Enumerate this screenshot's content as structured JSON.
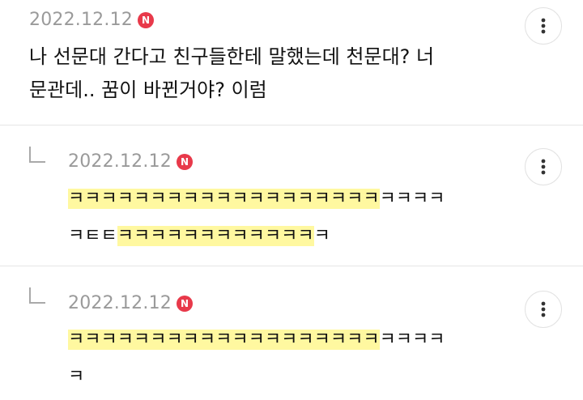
{
  "comments": [
    {
      "date": "2022.12.12",
      "badge": "N",
      "lines": [
        "나 선문대 간다고 친구들한테 말했는데 천문대? 너",
        "문관데.. 꿈이 바뀐거야? 이럼"
      ]
    },
    {
      "date": "2022.12.12",
      "badge": "N",
      "line1_highlight": "ㅋㅋㅋㅋㅋㅋㅋㅋㅋㅋㅋㅋㅋㅋㅋㅋㅋㅋㅋ",
      "line1_rest": "ㅋㅋㅋㅋ",
      "line2_pre": "ㅋㅌㅌ",
      "line2_highlight": "ㅋㅋㅋㅋㅋㅋㅋㅋㅋㅋㅋㅋ",
      "line2_rest": "ㅋ"
    },
    {
      "date": "2022.12.12",
      "badge": "N",
      "line1_highlight": "ㅋㅋㅋㅋㅋㅋㅋㅋㅋㅋㅋㅋㅋㅋㅋㅋㅋㅋㅋ",
      "line1_rest": "ㅋㅋㅋㅋ",
      "line2": "ㅋ"
    }
  ],
  "icons": {
    "more": "more-vertical-icon",
    "reply": "reply-corner-icon",
    "new": "new-badge-icon"
  },
  "colors": {
    "badge": "#e8394a",
    "highlight": "#fff8a0",
    "date": "#9a9a9a"
  }
}
